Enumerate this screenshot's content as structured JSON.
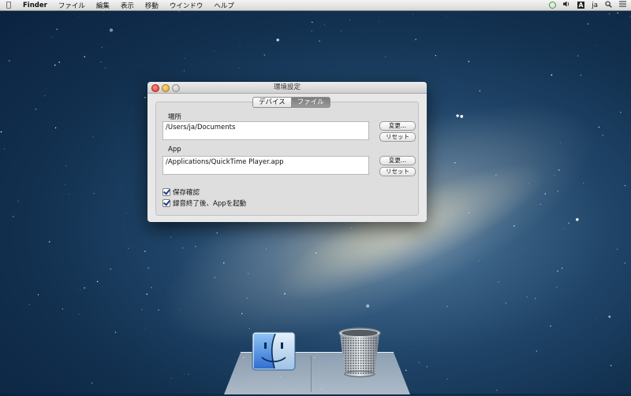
{
  "menubar": {
    "app_name": "Finder",
    "items": [
      "ファイル",
      "編集",
      "表示",
      "移動",
      "ウインドウ",
      "ヘルプ"
    ],
    "input_method": "A",
    "user": "ja",
    "icons": [
      "apple-icon",
      "status-circle-icon",
      "volume-icon",
      "input-source-icon",
      "search-icon",
      "list-icon"
    ]
  },
  "window": {
    "title": "環境設定",
    "tabs": [
      {
        "label": "デバイス",
        "selected": false
      },
      {
        "label": "ファイル",
        "selected": true
      }
    ],
    "location": {
      "label": "場所",
      "path": "/Users/ja/Documents",
      "change_button": "変更...",
      "reset_button": "リセット"
    },
    "app": {
      "label": "App",
      "path": "/Applications/QuickTime Player.app",
      "change_button": "変更...",
      "reset_button": "リセット"
    },
    "options": [
      {
        "label": "保存確認",
        "checked": true
      },
      {
        "label": "録音終了後、Appを起動",
        "checked": true
      }
    ]
  },
  "dock": {
    "items": [
      "finder-icon",
      "trash-icon"
    ]
  },
  "colors": {
    "selected_tab": "#8a8a8a",
    "check_mark": "#1a3d8f"
  }
}
